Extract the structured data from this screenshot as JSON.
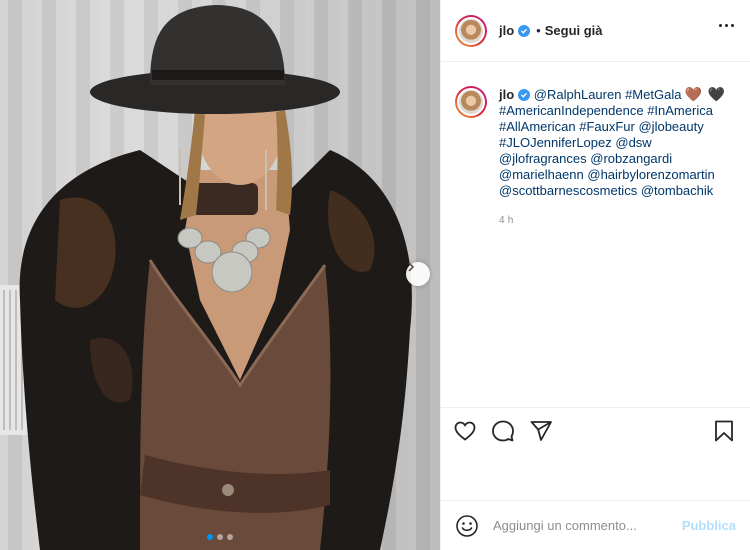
{
  "post": {
    "username": "jlo",
    "follow_status": "Segui già",
    "separator": "•",
    "caption": {
      "mentions": [
        "@RalphLauren",
        "#MetGala",
        "#AmericanIndependence",
        "#InAmerica",
        "#AllAmerican",
        "#FauxFur",
        "@jlobeauty",
        "#JLOJenniferLopez",
        "@dsw",
        "@jlofragrances",
        "@robzangardi",
        "@marielhaenn",
        "@hairbylorenzomartin",
        "@scottbarnescosmetics",
        "@tombachik"
      ],
      "hearts": [
        "🤎",
        "🖤"
      ]
    },
    "time": "4 h",
    "carousel": {
      "slide_count": 3,
      "active_index": 0
    }
  },
  "comment": {
    "placeholder": "Aggiungi un commento...",
    "publish_label": "Pubblica"
  },
  "colors": {
    "link": "#00376b",
    "verified": "#3897f0",
    "publish_disabled": "#b2dffc",
    "carousel_active": "#0095f6"
  },
  "icons": {
    "more": "more-icon",
    "like": "heart-icon",
    "comment": "comment-icon",
    "share": "share-icon",
    "save": "bookmark-icon",
    "emoji": "emoji-icon",
    "next": "chevron-right-icon",
    "verified": "verified-badge-icon"
  }
}
